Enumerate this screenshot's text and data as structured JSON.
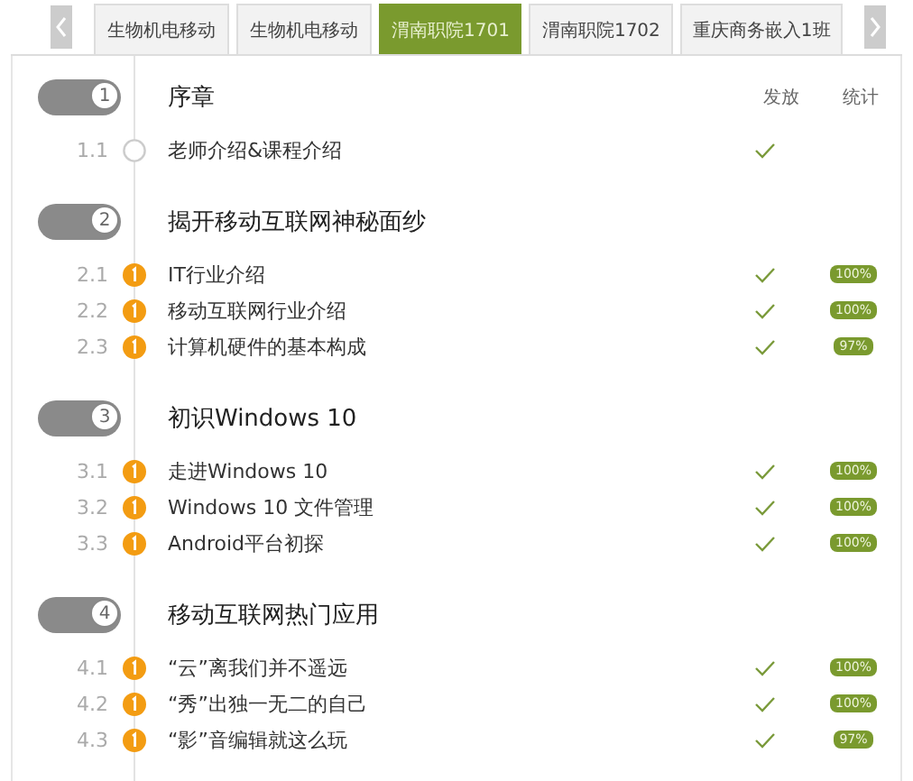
{
  "tabs": [
    {
      "label": "生物机电移动",
      "selected": false
    },
    {
      "label": "生物机电移动",
      "selected": false
    },
    {
      "label": "渭南职院1701",
      "selected": true
    },
    {
      "label": "渭南职院1702",
      "selected": false
    },
    {
      "label": "重庆商务嵌入1班",
      "selected": false
    }
  ],
  "columns": [
    "发放",
    "统计"
  ],
  "chapters": [
    {
      "number": "1",
      "title": "序章",
      "lessons": [
        {
          "number": "1.1",
          "title": "老师介绍&课程介绍",
          "kind": "empty",
          "released": true
        }
      ]
    },
    {
      "number": "2",
      "title": "揭开移动互联网神秘面纱",
      "lessons": [
        {
          "number": "2.1",
          "title": "IT行业介绍",
          "kind": "alert",
          "released": true,
          "stat": "100%"
        },
        {
          "number": "2.2",
          "title": "移动互联网行业介绍",
          "kind": "alert",
          "released": true,
          "stat": "100%"
        },
        {
          "number": "2.3",
          "title": "计算机硬件的基本构成",
          "kind": "alert",
          "released": true,
          "stat": "97%"
        }
      ]
    },
    {
      "number": "3",
      "title": "初识Windows 10",
      "lessons": [
        {
          "number": "3.1",
          "title": "走进Windows 10",
          "kind": "alert",
          "released": true,
          "stat": "100%"
        },
        {
          "number": "3.2",
          "title": "Windows 10 文件管理",
          "kind": "alert",
          "released": true,
          "stat": "100%"
        },
        {
          "number": "3.3",
          "title": "Android平台初探",
          "kind": "alert",
          "released": true,
          "stat": "100%"
        }
      ]
    },
    {
      "number": "4",
      "title": "移动互联网热门应用",
      "lessons": [
        {
          "number": "4.1",
          "title": "“云”离我们并不遥远",
          "kind": "alert",
          "released": true,
          "stat": "100%"
        },
        {
          "number": "4.2",
          "title": "“秀”出独一无二的自己",
          "kind": "alert",
          "released": true,
          "stat": "100%"
        },
        {
          "number": "4.3",
          "title": "“影”音编辑就这么玩",
          "kind": "alert",
          "released": true,
          "stat": "97%"
        }
      ]
    }
  ]
}
